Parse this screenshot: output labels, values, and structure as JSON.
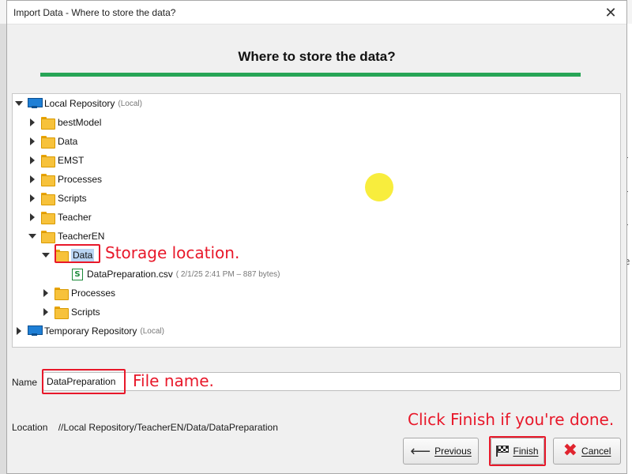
{
  "dialog": {
    "title": "Import Data - Where to store the data?",
    "heading": "Where to store the data?",
    "accent_color": "#27a556",
    "close_glyph": "✕"
  },
  "tree": {
    "local_repo": {
      "label": "Local Repository",
      "sub": "(Local)"
    },
    "folders": {
      "bestModel": "bestModel",
      "Data": "Data",
      "EMST": "EMST",
      "Processes": "Processes",
      "Scripts": "Scripts",
      "Teacher": "Teacher",
      "TeacherEN": "TeacherEN"
    },
    "teacheren_children": {
      "data_selected": "Data",
      "csv": {
        "label": "DataPreparation.csv",
        "sub": "( 2/1/25 2:41 PM – 887 bytes)",
        "icon_glyph": "S"
      },
      "processes": "Processes",
      "scripts": "Scripts"
    },
    "temp_repo": {
      "label": "Temporary Repository",
      "sub": "(Local)"
    }
  },
  "annotations": {
    "storage": "Storage location.",
    "filename": "File name.",
    "finish": "Click Finish if you're done.",
    "color": "#e8182a"
  },
  "form": {
    "name_label": "Name",
    "name_value": "DataPreparation",
    "location_label": "Location",
    "location_value": "//Local Repository/TeacherEN/Data/DataPreparation"
  },
  "buttons": {
    "previous": "Previous",
    "previous_icon": "⟵",
    "finish": "Finish",
    "cancel": "Cancel",
    "cancel_icon": "✖"
  },
  "background": {
    "right_chars": [
      "l",
      "l",
      "r",
      "r",
      "r",
      "e"
    ]
  }
}
